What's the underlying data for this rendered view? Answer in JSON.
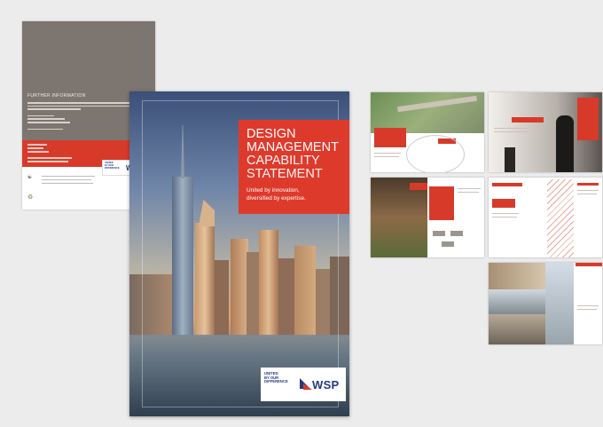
{
  "back_cover": {
    "heading": "FURTHER INFORMATION",
    "logo_text": [
      "UNITED",
      "BY OUR",
      "DIFFERENCE"
    ],
    "logo_brand": "WSP"
  },
  "front_cover": {
    "title_lines": [
      "DESIGN",
      "MANAGEMENT",
      "CAPABILITY",
      "STATEMENT"
    ],
    "subtitle_lines": [
      "United by innovation,",
      "diversified by expertise."
    ],
    "logo_text": [
      "UNITED",
      "BY OUR",
      "DIFFERENCE"
    ],
    "logo_brand": "WSP"
  },
  "colors": {
    "accent_red": "#de3a2c",
    "brand_blue": "#223a84",
    "back_grey": "#7d7570",
    "background": "#ececec"
  }
}
